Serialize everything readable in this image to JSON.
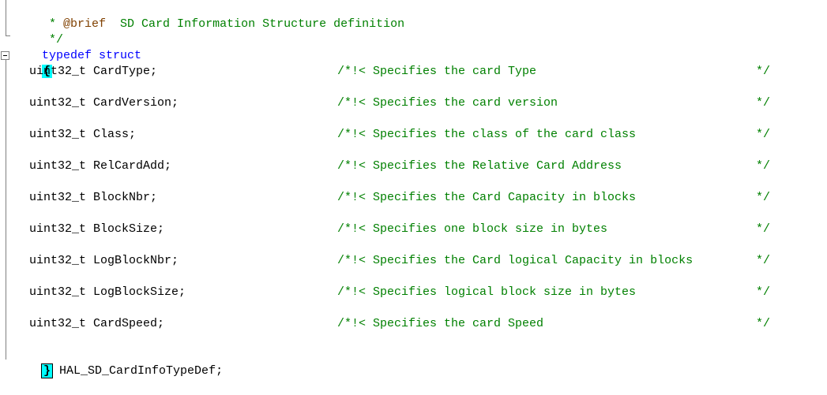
{
  "header": {
    "brief_prefix": " * ",
    "brief_tag": "@brief",
    "brief_text": "  SD Card Information Structure definition",
    "comment_close": " */"
  },
  "decl": {
    "keyword": "typedef struct",
    "open_brace": "{",
    "close_brace": "}",
    "type_name": " HAL_SD_CardInfoTypeDef;"
  },
  "fields": [
    {
      "decl": "uint32_t CardType;",
      "comment": "/*!< Specifies the card Type",
      "end": "*/"
    },
    {
      "decl": "uint32_t CardVersion;",
      "comment": "/*!< Specifies the card version",
      "end": "*/"
    },
    {
      "decl": "uint32_t Class;",
      "comment": "/*!< Specifies the class of the card class",
      "end": "*/"
    },
    {
      "decl": "uint32_t RelCardAdd;",
      "comment": "/*!< Specifies the Relative Card Address",
      "end": "*/"
    },
    {
      "decl": "uint32_t BlockNbr;",
      "comment": "/*!< Specifies the Card Capacity in blocks",
      "end": "*/"
    },
    {
      "decl": "uint32_t BlockSize;",
      "comment": "/*!< Specifies one block size in bytes",
      "end": "*/"
    },
    {
      "decl": "uint32_t LogBlockNbr;",
      "comment": "/*!< Specifies the Card logical Capacity in blocks",
      "end": "*/"
    },
    {
      "decl": "uint32_t LogBlockSize;",
      "comment": "/*!< Specifies logical block size in bytes",
      "end": "*/"
    },
    {
      "decl": "uint32_t CardSpeed;",
      "comment": "/*!< Specifies the card Speed",
      "end": "*/"
    }
  ]
}
